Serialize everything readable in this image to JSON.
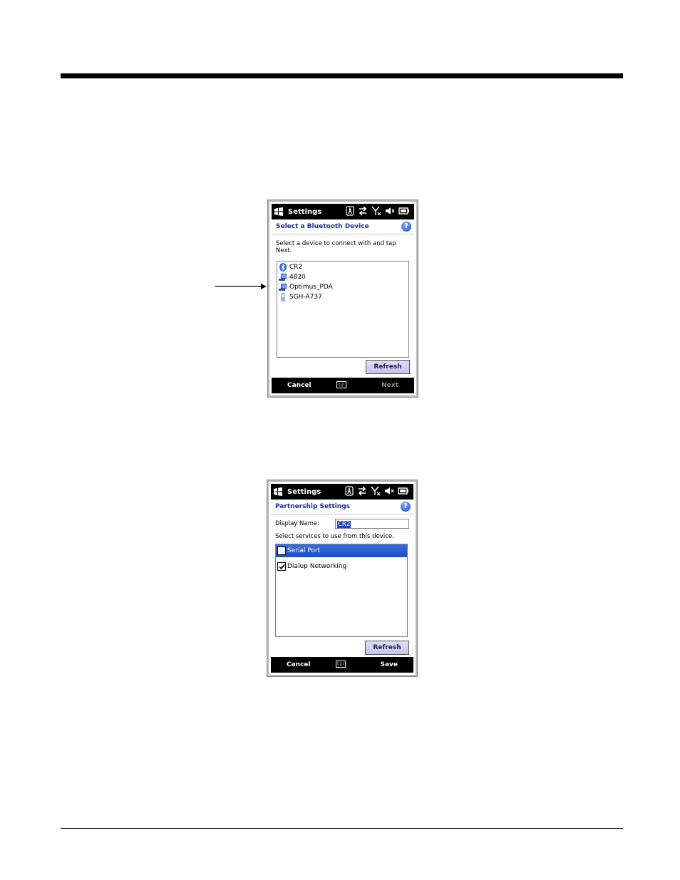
{
  "screen1": {
    "app_title": "Settings",
    "header": "Select a Bluetooth Device",
    "help_label": "?",
    "instruction": "Select a device to connect with and tap Next.",
    "devices": [
      {
        "label": "CR2",
        "icon": "bluetooth-icon"
      },
      {
        "label": "4820",
        "icon": "computer-icon"
      },
      {
        "label": "Optimus_PDA",
        "icon": "computer-icon"
      },
      {
        "label": "SGH-A737",
        "icon": "phone-icon"
      }
    ],
    "refresh_label": "Refresh",
    "left_soft_key": "Cancel",
    "right_soft_key": "Next"
  },
  "screen2": {
    "app_title": "Settings",
    "header": "Partnership Settings",
    "help_label": "?",
    "display_name_label": "Display Name:",
    "display_name_value": "CR2",
    "services_prompt": "Select services to use from this device.",
    "services": [
      {
        "label": "Serial Port",
        "checked": false,
        "selected": true
      },
      {
        "label": "Dialup Networking",
        "checked": true,
        "selected": false
      }
    ],
    "refresh_label": "Refresh",
    "left_soft_key": "Cancel",
    "right_soft_key": "Save"
  },
  "colors": {
    "header_text": "#1a2f9a",
    "selection": "#1d4bc6",
    "button_face": "#c4c6ec"
  }
}
